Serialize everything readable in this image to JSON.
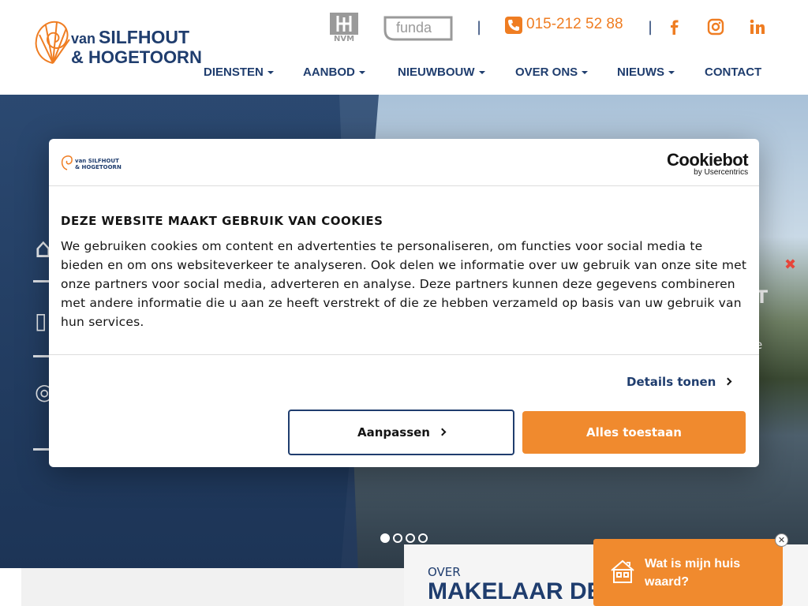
{
  "header": {
    "logo": {
      "line1_small": "van",
      "line1": "SILFHOUT",
      "line2": "& HOGETOORN"
    },
    "nvm_label": "NVM",
    "funda_label": "funda",
    "separator": "|",
    "phone": "015-212 52 88",
    "nav": [
      {
        "label": "DIENSTEN",
        "has_caret": true
      },
      {
        "label": "AANBOD",
        "has_caret": true
      },
      {
        "label": "NIEUWBOUW",
        "has_caret": true
      },
      {
        "label": "OVER ONS",
        "has_caret": true
      },
      {
        "label": "NIEUWS",
        "has_caret": true
      },
      {
        "label": "CONTACT",
        "has_caret": false
      }
    ],
    "social_icons": [
      "facebook-icon",
      "instagram-icon",
      "linkedin-icon"
    ]
  },
  "colors": {
    "brand_blue": "#1f3d6e",
    "accent_orange": "#f08a2e",
    "close_red": "#e8463b"
  },
  "hero": {
    "side_text": "T",
    "side_text2": "e",
    "slides": 4,
    "active_slide": 1
  },
  "cookie": {
    "brand": "Cookiebot",
    "brand_sub": "by Usercentrics",
    "title": "DEZE WEBSITE MAAKT GEBRUIK VAN COOKIES",
    "body": "We gebruiken cookies om content en advertenties te personaliseren, om functies voor social media te bieden en om ons websiteverkeer te analyseren. Ook delen we informatie over uw gebruik van onze site met onze partners voor social media, adverteren en analyse. Deze partners kunnen deze gegevens combineren met andere informatie die u aan ze heeft verstrekt of die ze hebben verzameld op basis van uw gebruik van hun services.",
    "details_label": "Details tonen",
    "customize_label": "Aanpassen",
    "accept_label": "Alles toestaan"
  },
  "about": {
    "label": "OVER",
    "title": "MAKELAAR DEL"
  },
  "widget": {
    "text": "Wat is mijn huis waard?",
    "close": "✕"
  }
}
